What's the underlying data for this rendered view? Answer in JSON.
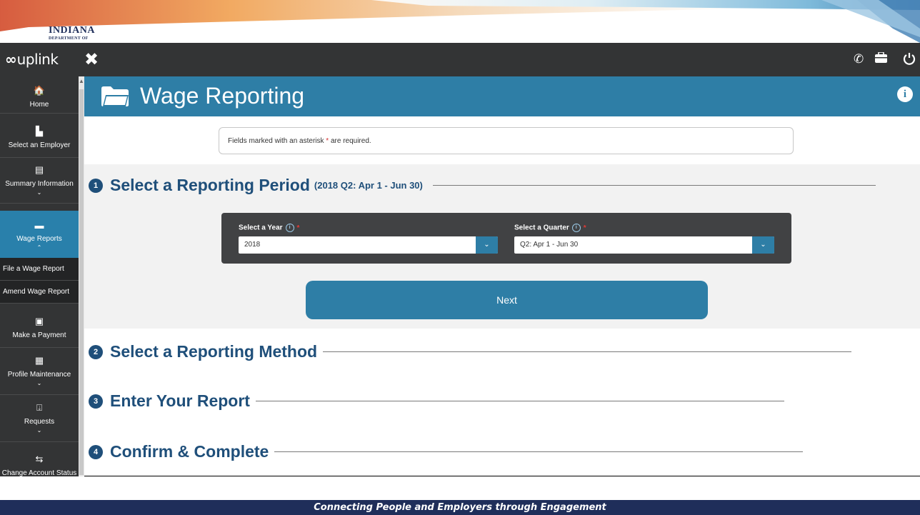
{
  "banner": {
    "logo_main": "INDIANA",
    "logo_sub": "DEPARTMENT OF"
  },
  "topbar": {
    "brand": "uplink",
    "brand_symbol": "∞",
    "close_icon": "close-icon",
    "icons": [
      "phone-icon",
      "briefcase-icon",
      "power-icon"
    ]
  },
  "sidebar": {
    "items": [
      {
        "label": "Home",
        "icon": "home-icon"
      },
      {
        "label": "Select an Employer",
        "icon": "building-icon"
      },
      {
        "label": "Summary Information",
        "icon": "document-icon"
      },
      {
        "label": "Wage Reports",
        "icon": "folder-icon"
      },
      {
        "label": "Make a Payment",
        "icon": "money-icon"
      },
      {
        "label": "Profile Maintenance",
        "icon": "building-icon"
      },
      {
        "label": "Requests",
        "icon": "inbox-icon"
      },
      {
        "label": "Change Account Status",
        "icon": "exchange-icon"
      }
    ],
    "subitems": [
      {
        "label": "File a Wage Report"
      },
      {
        "label": "Amend Wage Report"
      }
    ]
  },
  "page": {
    "title": "Wage Reporting",
    "notice_prefix": "Fields marked with an asterisk ",
    "notice_asterisk": "*",
    "notice_suffix": " are required."
  },
  "steps": [
    {
      "number": "1",
      "label": "Select a Reporting Period",
      "sub": "(2018 Q2: Apr 1 - Jun 30)"
    },
    {
      "number": "2",
      "label": "Select a Reporting Method"
    },
    {
      "number": "3",
      "label": "Enter Your Report"
    },
    {
      "number": "4",
      "label": "Confirm & Complete"
    }
  ],
  "form": {
    "year_label": "Select a Year",
    "year_value": "2018",
    "quarter_label": "Select a Quarter",
    "quarter_value": "Q2: Apr 1 - Jun 30",
    "required_mark": "*",
    "next_label": "Next"
  },
  "footer": {
    "tagline": "Connecting People and Employers through Engagement"
  },
  "colors": {
    "accent": "#2e7ea6",
    "dark": "#333435",
    "heading": "#1f4f7a",
    "footer": "#1f2e5a",
    "required": "#e53935"
  }
}
